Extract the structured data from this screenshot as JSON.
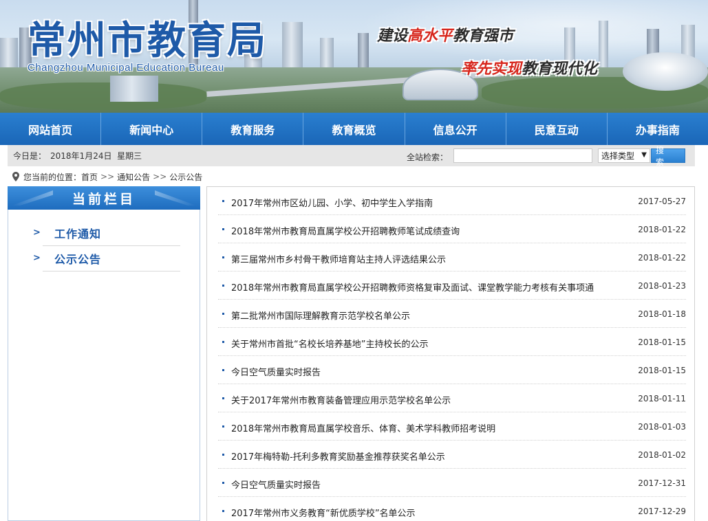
{
  "header": {
    "logo_cn": "常州市教育局",
    "logo_en": "Changzhou Municipal Education Bureau",
    "slogan1_a": "建设",
    "slogan1_hl": "高水平",
    "slogan1_b": "教育强市",
    "slogan2_hl": "率先实现",
    "slogan2_b": "教育现代化"
  },
  "nav": [
    "网站首页",
    "新闻中心",
    "教育服务",
    "教育概览",
    "信息公开",
    "民意互动",
    "办事指南"
  ],
  "infobar": {
    "date_label": "今日是：",
    "date_value": "2018年1月24日  星期三",
    "search_label": "全站检索：",
    "search_value": "",
    "select_value": "选择类型",
    "search_button": "搜 索"
  },
  "breadcrumb": {
    "prefix": "您当前的位置：",
    "items": [
      "首页",
      "通知公告",
      "公示公告"
    ],
    "sep": ">>"
  },
  "sidebar": {
    "title": "当前栏目",
    "items": [
      "工作通知",
      "公示公告"
    ]
  },
  "list": [
    {
      "title": "2017年常州市区幼儿园、小学、初中学生入学指南",
      "date": "2017-05-27"
    },
    {
      "title": "2018年常州市教育局直属学校公开招聘教师笔试成绩查询",
      "date": "2018-01-22"
    },
    {
      "title": "第三届常州市乡村骨干教师培育站主持人评选结果公示",
      "date": "2018-01-22"
    },
    {
      "title": "2018年常州市教育局直属学校公开招聘教师资格复审及面试、课堂教学能力考核有关事项通",
      "date": "2018-01-23"
    },
    {
      "title": "第二批常州市国际理解教育示范学校名单公示",
      "date": "2018-01-18"
    },
    {
      "title": "关于常州市首批“名校长培养基地”主持校长的公示",
      "date": "2018-01-15"
    },
    {
      "title": "今日空气质量实时报告",
      "date": "2018-01-15"
    },
    {
      "title": "关于2017年常州市教育装备管理应用示范学校名单公示",
      "date": "2018-01-11"
    },
    {
      "title": "2018年常州市教育局直属学校音乐、体育、美术学科教师招考说明",
      "date": "2018-01-03"
    },
    {
      "title": "2017年梅特勒-托利多教育奖励基金推荐获奖名单公示",
      "date": "2018-01-02"
    },
    {
      "title": "今日空气质量实时报告",
      "date": "2017-12-31"
    },
    {
      "title": "2017年常州市义务教育“新优质学校”名单公示",
      "date": "2017-12-29"
    }
  ]
}
